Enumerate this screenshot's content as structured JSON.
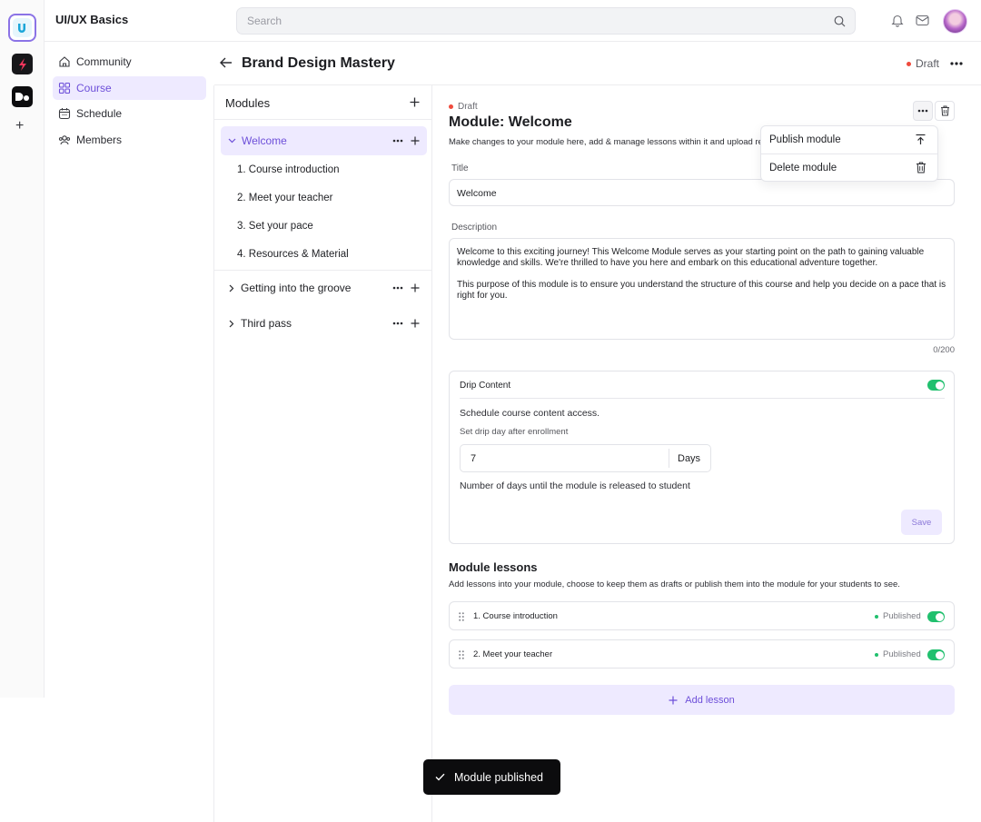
{
  "app": {
    "title": "UI/UX Basics"
  },
  "search": {
    "placeholder": "Search"
  },
  "colors": {
    "accent": "#6d4fd9",
    "accent_bg": "#eeeaff",
    "success": "#21c06e",
    "draft_dot": "#ef4a3c"
  },
  "rail": {
    "add_label": "+"
  },
  "nav": {
    "items": [
      {
        "label": "Community",
        "icon": "home-icon"
      },
      {
        "label": "Course",
        "icon": "grid-icon",
        "active": true
      },
      {
        "label": "Schedule",
        "icon": "calendar-icon"
      },
      {
        "label": "Members",
        "icon": "users-icon"
      }
    ]
  },
  "course": {
    "title": "Brand Design Mastery",
    "status": "Draft"
  },
  "modules_panel": {
    "title": "Modules",
    "modules": [
      {
        "label": "Welcome",
        "expanded": true,
        "lessons": [
          "1. Course introduction",
          "2. Meet your teacher",
          "3. Set your pace",
          "4. Resources & Material"
        ]
      },
      {
        "label": "Getting into the groove",
        "expanded": false
      },
      {
        "label": "Third pass",
        "expanded": false
      }
    ]
  },
  "module": {
    "status": "Draft",
    "title": "Module: Welcome",
    "subtitle": "Make changes to your module here, add & manage lessons within it and upload re",
    "title_label": "Title",
    "title_value": "Welcome",
    "description_label": "Description",
    "description_p1": "Welcome to this exciting journey! This Welcome Module serves as your starting point on the path to gaining valuable knowledge and skills. We're thrilled to have you here and embark on this educational adventure together.",
    "description_p2": "This purpose of this module is to ensure you understand the structure of this course and help you decide on a pace that is right for you.",
    "char_count": "0/200"
  },
  "menu": {
    "publish": "Publish module",
    "delete": "Delete module"
  },
  "drip": {
    "title": "Drip Content",
    "enabled": true,
    "description": "Schedule course content access.",
    "field_label": "Set drip day after enrollment",
    "days_value": "7",
    "days_unit": "Days",
    "help": "Number of days until the module is released to student",
    "save_label": "Save"
  },
  "lessons_section": {
    "title": "Module lessons",
    "subtitle": "Add lessons into your module, choose to keep them as drafts or publish them into the module for your students to see.",
    "lessons": [
      {
        "title": "1. Course introduction",
        "status": "Published",
        "published": true
      },
      {
        "title": "2. Meet your teacher",
        "status": "Published",
        "published": true
      }
    ],
    "add_label": "Add lesson"
  },
  "toast": {
    "message": "Module published"
  }
}
